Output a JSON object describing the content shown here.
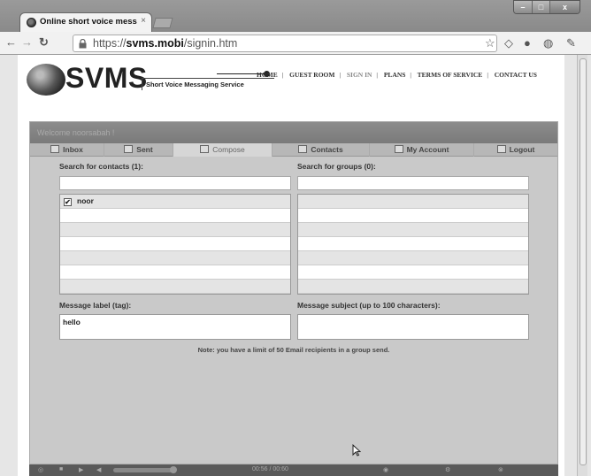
{
  "browser": {
    "tab_title": "Online short voice messagi",
    "tab_close": "×",
    "url_prefix": "https://",
    "url_domain": "svms.mobi",
    "url_path": "/signin.htm",
    "win_min": "–",
    "win_max": "□",
    "win_close": "x"
  },
  "site": {
    "logo_text": "SVMS",
    "logo_tagline": "Short Voice Messaging Service",
    "nav": [
      {
        "label": "HOME"
      },
      {
        "label": "GUEST ROOM"
      },
      {
        "label": "SIGN IN"
      },
      {
        "label": "PLANS"
      },
      {
        "label": "TERMS OF SERVICE"
      },
      {
        "label": "CONTACT US"
      }
    ],
    "nav_sep": "|"
  },
  "panel": {
    "welcome": "Welcome noorsabah !",
    "tabs": [
      {
        "label": "Inbox"
      },
      {
        "label": "Sent"
      },
      {
        "label": "Compose"
      },
      {
        "label": "Contacts"
      },
      {
        "label": "My Account"
      },
      {
        "label": "Logout"
      }
    ],
    "search_contacts_label": "Search for contacts (1):",
    "search_groups_label": "Search for groups (0):",
    "contacts": [
      {
        "name": "noor",
        "checked": true
      }
    ],
    "check_mark": "✔",
    "message_label_label": "Message label (tag):",
    "message_label_value": "hello",
    "message_subject_label": "Message subject (up to 100 characters):",
    "message_subject_value": "",
    "note": "Note: you have a limit of 50 Email recipients in a group send."
  },
  "player": {
    "time": "00:56 / 00:60"
  }
}
